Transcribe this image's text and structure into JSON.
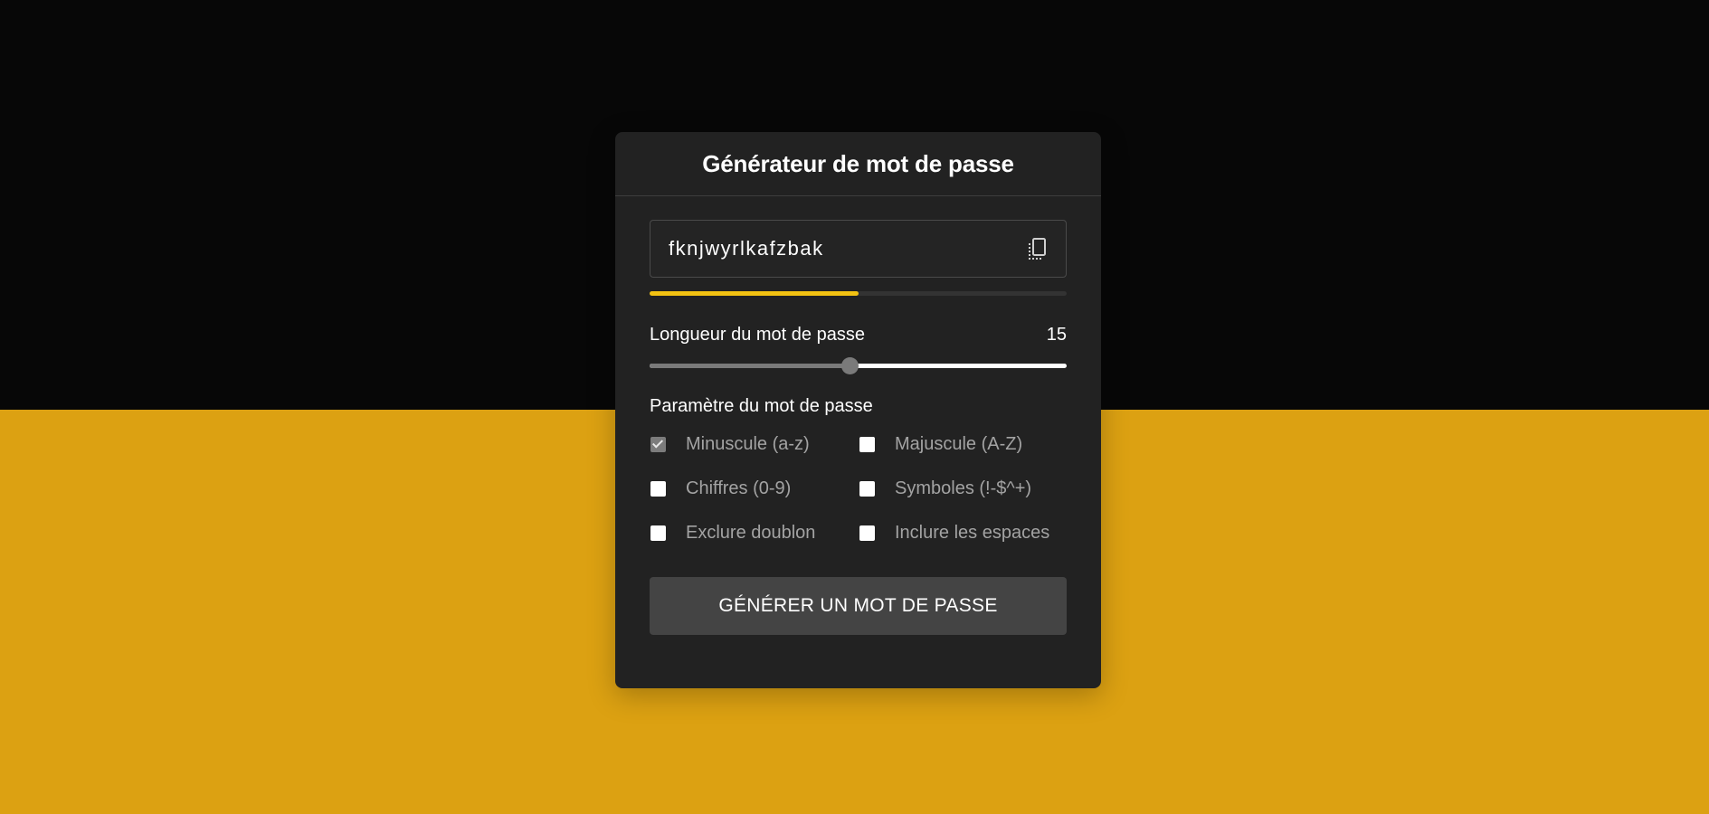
{
  "app": {
    "title": "Générateur de mot de passe"
  },
  "password": {
    "value": "fknjwyrlkafzbak",
    "copy_icon": "copy-icon",
    "strength_fraction": 0.5,
    "strength_color": "#f3c212"
  },
  "length": {
    "label": "Longueur du mot de passe",
    "value": "15",
    "slider_fraction": 0.48
  },
  "settings": {
    "title": "Paramètre du mot de passe",
    "options": [
      {
        "label": "Minuscule (a-z)",
        "checked": true
      },
      {
        "label": "Majuscule (A-Z)",
        "checked": false
      },
      {
        "label": "Chiffres (0-9)",
        "checked": false
      },
      {
        "label": "Symboles (!-$^+)",
        "checked": false
      },
      {
        "label": "Exclure doublon",
        "checked": false
      },
      {
        "label": "Inclure les espaces",
        "checked": false
      }
    ]
  },
  "actions": {
    "generate_label": "GÉNÉRER UN MOT DE PASSE"
  },
  "colors": {
    "background_top": "#070707",
    "background_bottom": "#dca112",
    "card": "#222222",
    "accent": "#f3c212"
  }
}
